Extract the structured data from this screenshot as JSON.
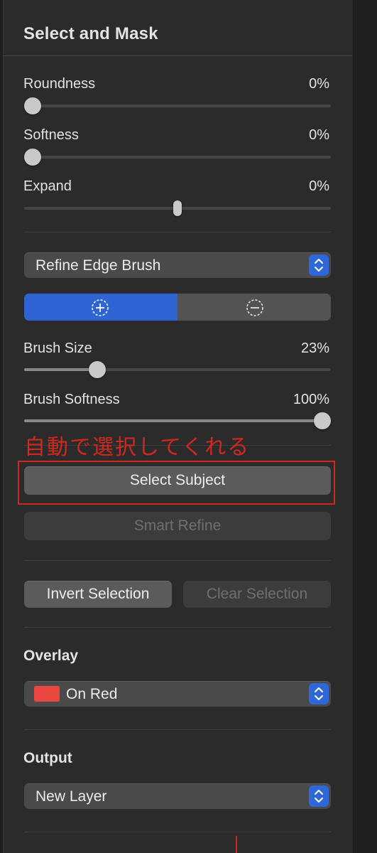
{
  "panel": {
    "title": "Select and Mask"
  },
  "sliders": {
    "roundness": {
      "label": "Roundness",
      "value": "0%",
      "level": 0
    },
    "softness": {
      "label": "Softness",
      "value": "0%",
      "level": 0
    },
    "expand": {
      "label": "Expand",
      "value": "0%",
      "level": 0.5
    },
    "brush_size": {
      "label": "Brush Size",
      "value": "23%",
      "level": 0.23
    },
    "brush_softness": {
      "label": "Brush Softness",
      "value": "100%",
      "level": 1
    }
  },
  "brush_mode": {
    "selected": "Refine Edge Brush"
  },
  "brush_toggle": {
    "add_icon": "plus-circle-icon",
    "subtract_icon": "minus-circle-icon",
    "active": "add"
  },
  "buttons": {
    "select_subject": "Select Subject",
    "smart_refine": "Smart Refine",
    "invert_selection": "Invert Selection",
    "clear_selection": "Clear Selection"
  },
  "overlay": {
    "title": "Overlay",
    "selected": "On Red",
    "swatch_color": "#e8463e"
  },
  "output": {
    "title": "Output",
    "selected": "New Layer"
  },
  "annotation": {
    "text": "自動で選択してくれる",
    "color": "#d0281f"
  },
  "colors": {
    "accent": "#2f64d4",
    "panel_bg": "#2b2b2b"
  }
}
